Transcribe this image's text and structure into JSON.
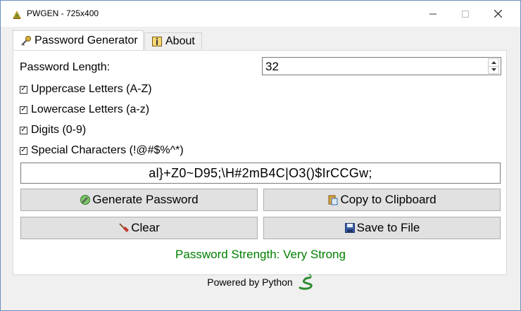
{
  "window": {
    "title": "PWGEN - 725x400",
    "minimize_icon": "minimize-icon",
    "maximize_icon": "maximize-icon",
    "close_icon": "close-icon"
  },
  "tabs": [
    {
      "label": "Password Generator",
      "icon": "key-icon"
    },
    {
      "label": "About",
      "icon": "info-icon"
    }
  ],
  "form": {
    "length_label": "Password Length:",
    "length_value": "32",
    "options": [
      {
        "label": "Uppercase Letters (A-Z)",
        "checked": true
      },
      {
        "label": "Lowercase Letters (a-z)",
        "checked": true
      },
      {
        "label": "Digits (0-9)",
        "checked": true
      },
      {
        "label": "Special Characters (!@#$%^*)",
        "checked": true
      }
    ],
    "password": "al}+Z0~D95;\\H#2mB4C|O3()$IrCCGw;"
  },
  "buttons": {
    "generate": "Generate Password",
    "copy": "Copy to Clipboard",
    "clear": "Clear",
    "save": "Save to File"
  },
  "strength": {
    "text": "Password Strength: Very Strong",
    "color": "#008000"
  },
  "footer": {
    "text": "Powered by Python",
    "icon": "python-snake-icon"
  }
}
